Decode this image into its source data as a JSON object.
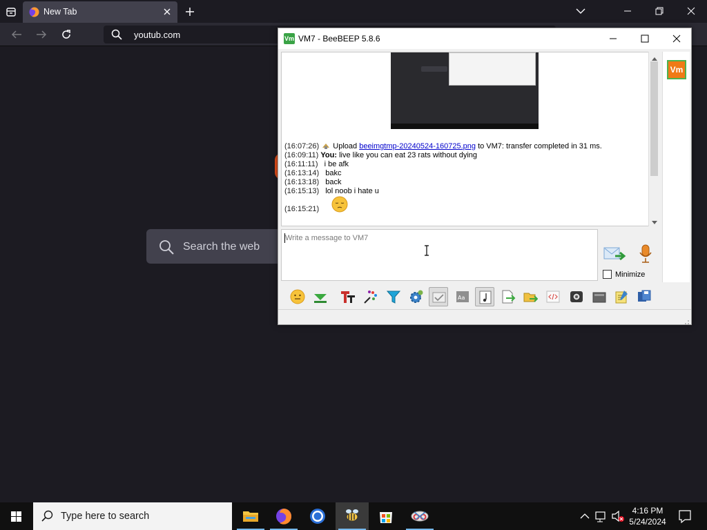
{
  "browser": {
    "tab_title": "New Tab",
    "url": "youtub.com",
    "search_placeholder": "Search the web"
  },
  "beebeep": {
    "title": "VM7 - BeeBEEP 5.8.6",
    "avatar_text": "Vm",
    "messages": [
      {
        "time": "(16:07:26)",
        "prefix": "Upload",
        "link": "beeimgtmp-20240524-160725.png",
        "suffix": "to VM7: transfer completed in 31 ms."
      },
      {
        "time": "(16:09:11)",
        "sender": "You:",
        "text": "live like you can eat 23 rats without dying"
      },
      {
        "time": "(16:11:11)",
        "text": "i be afk"
      },
      {
        "time": "(16:13:14)",
        "text": "bakc"
      },
      {
        "time": "(16:13:18)",
        "text": "back"
      },
      {
        "time": "(16:15:13)",
        "text": "lol noob i hate u"
      },
      {
        "time": "(16:15:21)",
        "emoji": "pensive-face"
      }
    ],
    "input_placeholder": "Write a message to VM7",
    "minimize_label": "Minimize",
    "minimize_checked": false,
    "toolbar_icons": [
      "emoji-icon",
      "green-arrow-icon",
      "font-icon",
      "color-palette-icon",
      "filter-icon",
      "settings-gear-icon",
      "spellcheck-icon",
      "compact-font-icon",
      "sound-icon",
      "send-file-icon",
      "send-folder-icon",
      "html-code-icon",
      "screenshot-icon",
      "clear-history-icon",
      "notes-icon",
      "save-icon"
    ]
  },
  "taskbar": {
    "search_placeholder": "Type here to search",
    "time": "4:16 PM",
    "date": "5/24/2024"
  }
}
